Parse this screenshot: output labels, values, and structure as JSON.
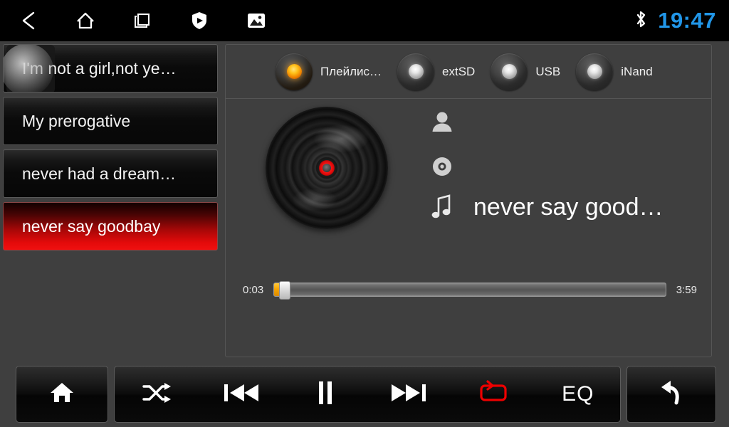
{
  "statusbar": {
    "nav": [
      {
        "name": "back-icon",
        "label": "Back"
      },
      {
        "name": "home-icon",
        "label": "Home"
      },
      {
        "name": "recents-icon",
        "label": "Recent apps"
      },
      {
        "name": "shield-play-icon",
        "label": "Protected media"
      },
      {
        "name": "image-icon",
        "label": "Screenshot"
      }
    ],
    "bluetooth_icon": "bluetooth-icon",
    "clock": "19:47",
    "clock_color": "#2196e8"
  },
  "playlist": {
    "items": [
      {
        "title": "I'm not a girl,not ye…",
        "selected": false,
        "ripple": true
      },
      {
        "title": "My prerogative",
        "selected": false,
        "ripple": false
      },
      {
        "title": "never had a dream…",
        "selected": false,
        "ripple": false
      },
      {
        "title": "never say goodbay",
        "selected": true,
        "ripple": false
      }
    ]
  },
  "sources": {
    "items": [
      {
        "label": "Плейлис…",
        "selected": true
      },
      {
        "label": "extSD",
        "selected": false
      },
      {
        "label": "USB",
        "selected": false
      },
      {
        "label": "iNand",
        "selected": false
      }
    ],
    "active_color": "#ffc21a"
  },
  "now_playing": {
    "album_art_icon": "vinyl-disc-icon",
    "artist_icon": "person-icon",
    "artist": "",
    "album_icon": "disc-icon",
    "album": "",
    "title_icon": "music-note-icon",
    "title": "never say good…",
    "elapsed": "0:03",
    "duration": "3:59",
    "progress_percent": 1.3
  },
  "controls": {
    "home": {
      "icon": "home-icon",
      "label": "Home"
    },
    "shuffle": {
      "icon": "shuffle-icon",
      "label": "Shuffle",
      "active": false
    },
    "previous": {
      "icon": "previous-track-icon",
      "label": "Previous"
    },
    "playpause": {
      "icon": "pause-icon",
      "label": "Pause"
    },
    "next": {
      "icon": "next-track-icon",
      "label": "Next"
    },
    "repeat": {
      "icon": "repeat-icon",
      "label": "Repeat",
      "active": true,
      "active_color": "#ee0000"
    },
    "eq": {
      "label": "EQ"
    },
    "back": {
      "icon": "back-arrow-icon",
      "label": "Back"
    }
  }
}
